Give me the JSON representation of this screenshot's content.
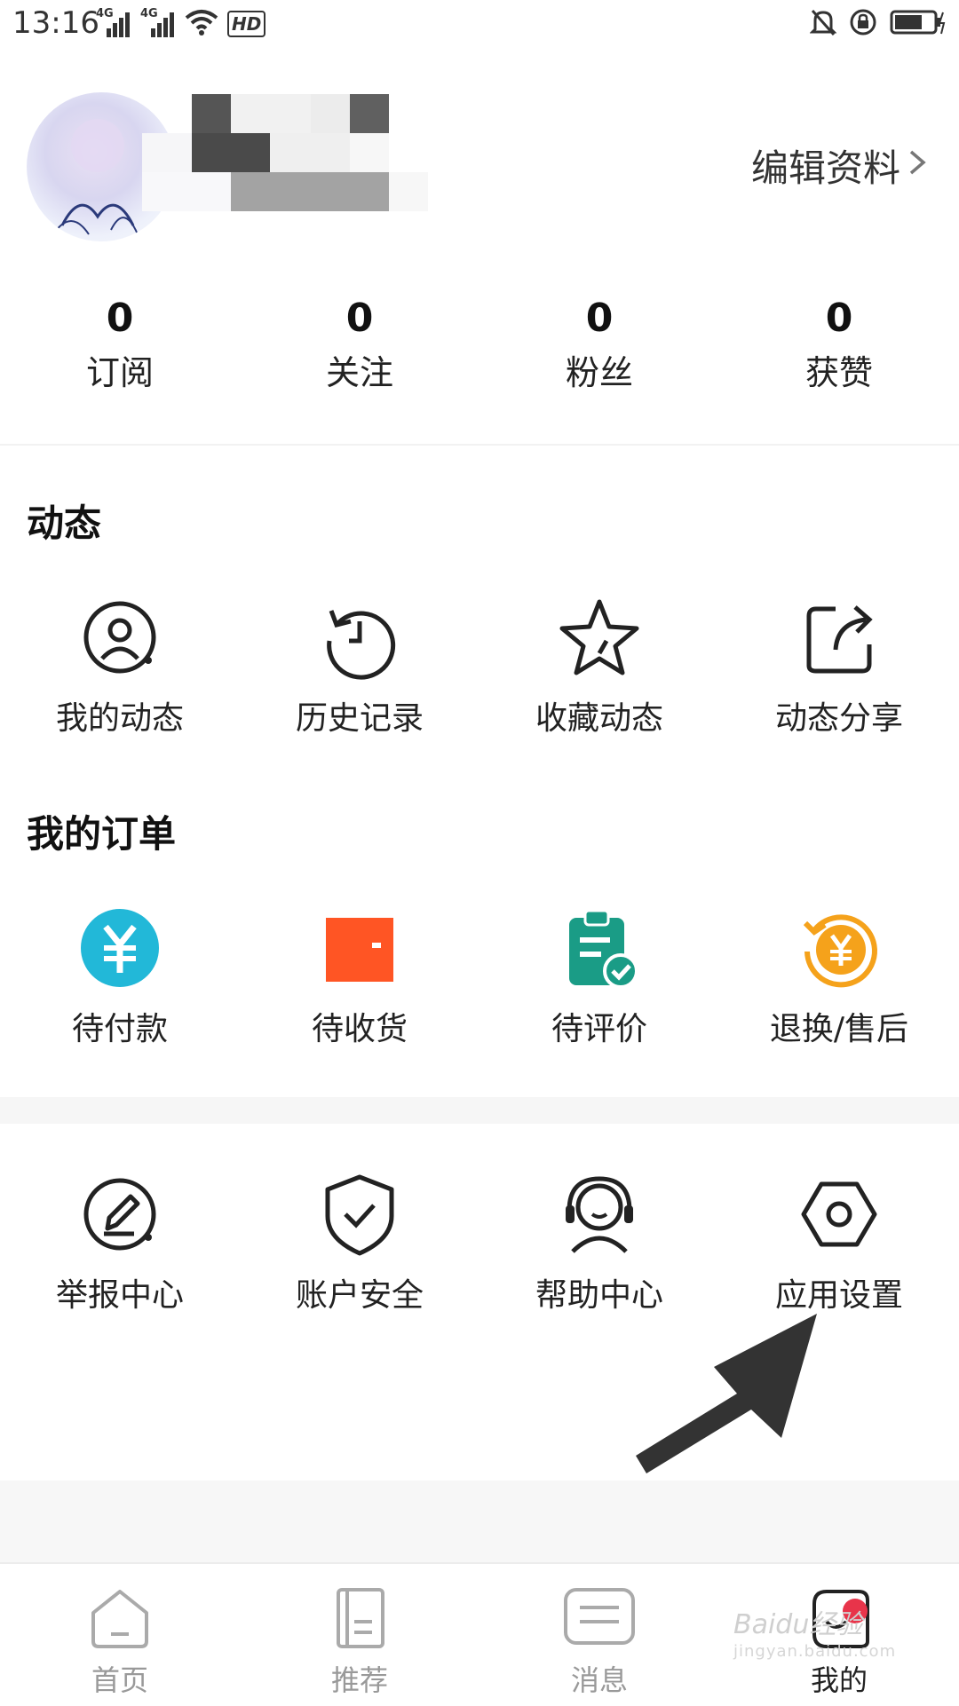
{
  "status_bar": {
    "time": "13:16",
    "network_1": "4G",
    "network_2": "4G",
    "hd_badge": "HD",
    "icons": [
      "signal-icon",
      "signal-icon",
      "wifi-icon",
      "hd-icon",
      "mute-icon",
      "lock-rotation-icon",
      "battery-icon"
    ]
  },
  "profile": {
    "edit_label": "编辑资料"
  },
  "stats": [
    {
      "value": "0",
      "label": "订阅"
    },
    {
      "value": "0",
      "label": "关注"
    },
    {
      "value": "0",
      "label": "粉丝"
    },
    {
      "value": "0",
      "label": "获赞"
    }
  ],
  "activity": {
    "title": "动态",
    "items": [
      {
        "label": "我的动态",
        "icon": "my-activity-icon"
      },
      {
        "label": "历史记录",
        "icon": "history-icon"
      },
      {
        "label": "收藏动态",
        "icon": "star-icon"
      },
      {
        "label": "动态分享",
        "icon": "share-icon"
      }
    ]
  },
  "orders": {
    "title": "我的订单",
    "items": [
      {
        "label": "待付款",
        "icon": "yen-icon",
        "color": "#22b8d8"
      },
      {
        "label": "待收货",
        "icon": "wallet-icon",
        "color": "#ff5524"
      },
      {
        "label": "待评价",
        "icon": "clipboard-check-icon",
        "color": "#1a9c86"
      },
      {
        "label": "退换/售后",
        "icon": "refund-icon",
        "color": "#f5a21b"
      }
    ]
  },
  "services": {
    "items": [
      {
        "label": "举报中心",
        "icon": "report-icon"
      },
      {
        "label": "账户安全",
        "icon": "shield-check-icon"
      },
      {
        "label": "帮助中心",
        "icon": "headset-icon"
      },
      {
        "label": "应用设置",
        "icon": "settings-hex-icon"
      }
    ]
  },
  "tabbar": {
    "items": [
      {
        "label": "首页",
        "icon": "home-icon"
      },
      {
        "label": "推荐",
        "icon": "book-icon"
      },
      {
        "label": "消息",
        "icon": "message-icon"
      },
      {
        "label": "我的",
        "icon": "profile-icon"
      }
    ],
    "active_index": 3
  },
  "watermark": {
    "text": "Baidu经验",
    "sub": "jingyan.baidu.com"
  }
}
